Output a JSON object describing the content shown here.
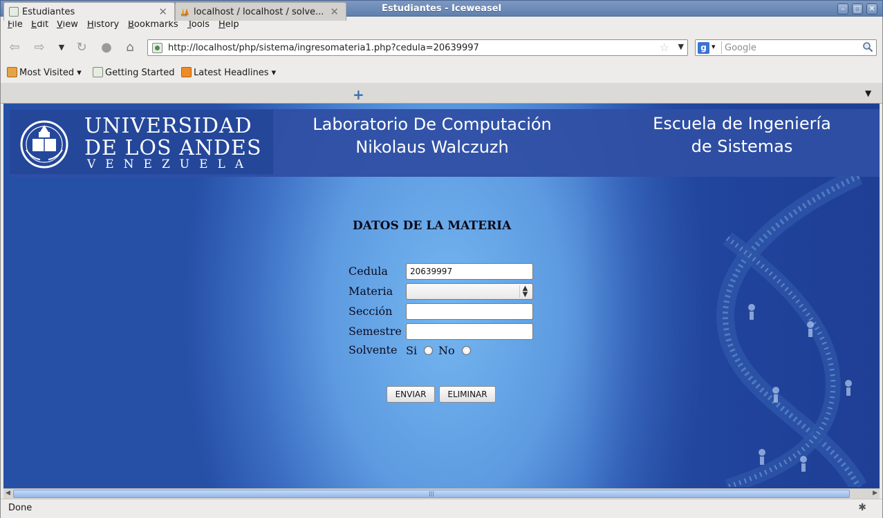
{
  "window": {
    "title": "Estudiantes - Iceweasel"
  },
  "menu": {
    "items": [
      {
        "label": "File",
        "accel": "F",
        "rest": "ile"
      },
      {
        "label": "Edit",
        "accel": "E",
        "rest": "dit"
      },
      {
        "label": "View",
        "accel": "V",
        "rest": "iew"
      },
      {
        "label": "History",
        "accel": "H",
        "rest": "istory"
      },
      {
        "label": "Bookmarks",
        "accel": "B",
        "rest": "ookmarks"
      },
      {
        "label": "Tools",
        "accel": "T",
        "rest": "ools"
      },
      {
        "label": "Help",
        "accel": "H",
        "rest": "elp"
      }
    ]
  },
  "nav": {
    "url": "http://localhost/php/sistema/ingresomateria1.php?cedula=20639997",
    "search_placeholder": "Google",
    "search_engine": "g"
  },
  "bookmarks": {
    "items": [
      "Most Visited",
      "Getting Started",
      "Latest Headlines"
    ]
  },
  "tabs": [
    {
      "label": "Estudiantes",
      "active": true
    },
    {
      "label": "localhost / localhost / solve...",
      "active": false
    }
  ],
  "header": {
    "logo_line1": "UNIVERSIDAD",
    "logo_line2": "DE LOS ANDES",
    "logo_line3": "VENEZUELA",
    "center_line1": "Laboratorio De Computación",
    "center_line2": "Nikolaus Walczuzh",
    "right_line1": "Escuela de Ingeniería",
    "right_line2": "de Sistemas"
  },
  "form": {
    "title": "DATOS DE LA MATERIA",
    "labels": {
      "cedula": "Cedula",
      "materia": "Materia",
      "seccion": "Sección",
      "semestre": "Semestre",
      "solvente": "Solvente",
      "si": "Si",
      "no": "No"
    },
    "values": {
      "cedula": "20639997",
      "materia": "",
      "seccion": "",
      "semestre": ""
    },
    "buttons": {
      "submit": "ENVIAR",
      "delete": "ELIMINAR"
    }
  },
  "status": {
    "text": "Done"
  },
  "colors": {
    "titlebar": "#6f8cba",
    "header_band": "#2f4fa3",
    "background_light": "#74b6f0",
    "background_dark": "#1f3f95"
  }
}
